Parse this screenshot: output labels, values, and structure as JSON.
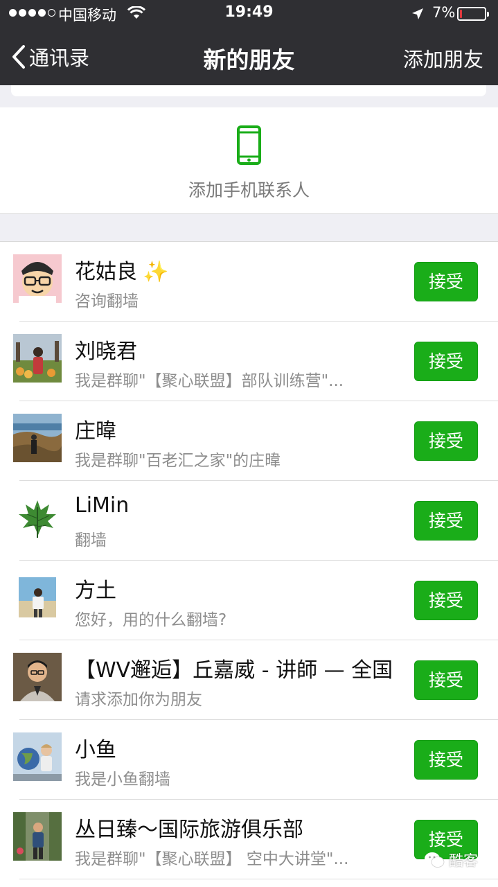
{
  "status_bar": {
    "carrier": "中国移动",
    "time": "19:49",
    "battery": "7%",
    "icons": [
      "signal-dots",
      "wifi-icon",
      "location-arrow-icon",
      "battery-icon"
    ]
  },
  "nav": {
    "back_label": "通讯录",
    "title": "新的朋友",
    "action_label": "添加朋友"
  },
  "add_phone": {
    "label": "添加手机联系人",
    "icon": "phone-icon"
  },
  "colors": {
    "nav_bg": "#2f2f33",
    "accent": "#1aad19",
    "page_bg": "#efeff4",
    "battery_low": "#e0383e"
  },
  "requests": [
    {
      "name": "花姑良",
      "emoji": "✨",
      "message": "咨询翻墙",
      "button": "接受"
    },
    {
      "name": "刘晓君",
      "message": "我是群聊\"【聚心联盟】部队训练营\"...",
      "button": "接受"
    },
    {
      "name": "庄暐",
      "message": "我是群聊\"百老汇之家\"的庄暐",
      "button": "接受"
    },
    {
      "name": "LiMin",
      "message": "翻墙",
      "button": "接受"
    },
    {
      "name": "方土",
      "message": "您好，用的什么翻墙?",
      "button": "接受"
    },
    {
      "name": "【WV邂逅】丘嘉威 - 讲師 — 全国",
      "message": "请求添加你为朋友",
      "button": "接受"
    },
    {
      "name": "小鱼",
      "message": "我是小鱼翻墙",
      "button": "接受"
    },
    {
      "name": "丛日臻～国际旅游俱乐部",
      "message": "我是群聊\"【聚心联盟】 空中大讲堂\"...",
      "button": "接受"
    }
  ],
  "watermark": {
    "text": "酷客"
  }
}
